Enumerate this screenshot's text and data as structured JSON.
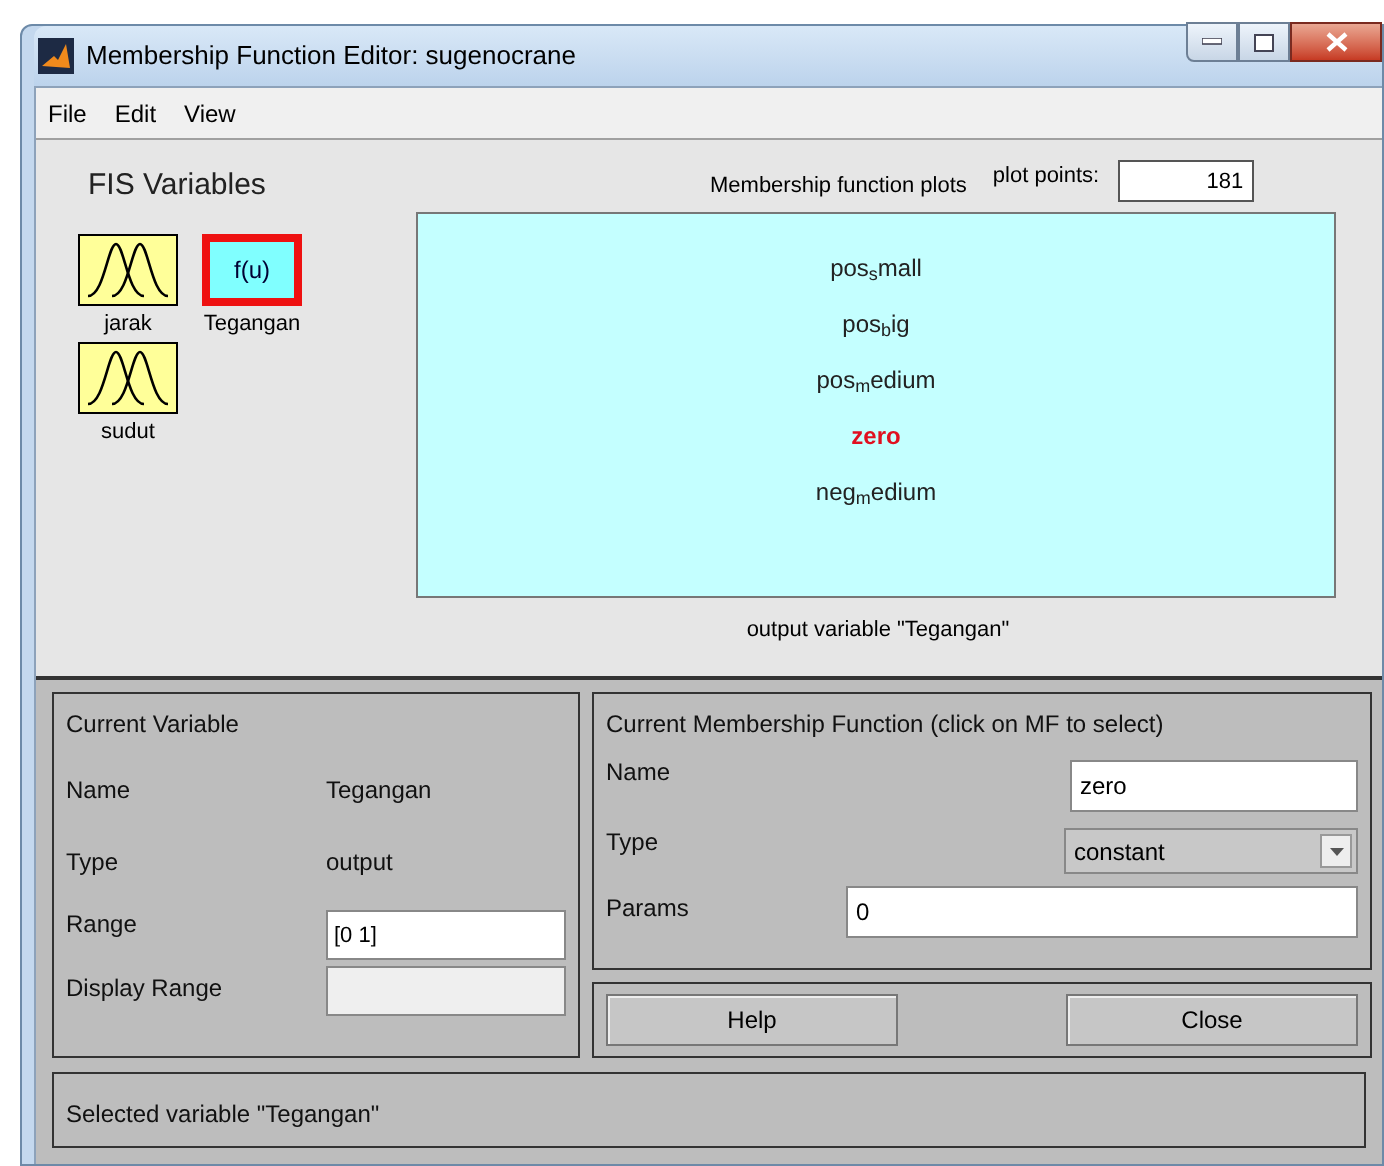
{
  "window": {
    "title": "Membership Function Editor: sugenocrane"
  },
  "menu": [
    "File",
    "Edit",
    "View"
  ],
  "fis_variables": {
    "title": "FIS Variables",
    "items": [
      {
        "label": "jarak",
        "kind": "input",
        "selected": false
      },
      {
        "label": "Tegangan",
        "kind": "output",
        "icon_text": "f(u)",
        "selected": true
      },
      {
        "label": "sudut",
        "kind": "input",
        "selected": false
      }
    ]
  },
  "plot": {
    "title": "Membership function plots",
    "plot_points_label": "plot points:",
    "plot_points": "181",
    "mfs": [
      {
        "label": "pos$_{s}$mall",
        "selected": false
      },
      {
        "label": "pos$_{b}$ig",
        "selected": false
      },
      {
        "label": "pos$_{m}$edium",
        "selected": false
      },
      {
        "label": "zero",
        "selected": true
      },
      {
        "label": "neg$_{m}$edium",
        "selected": false
      }
    ],
    "caption": "output variable \"Tegangan\""
  },
  "current_variable": {
    "title": "Current Variable",
    "name_label": "Name",
    "name": "Tegangan",
    "type_label": "Type",
    "type": "output",
    "range_label": "Range",
    "range": "[0 1]",
    "display_range_label": "Display Range"
  },
  "current_mf": {
    "title": "Current Membership Function (click on MF to select)",
    "name_label": "Name",
    "name": "zero",
    "type_label": "Type",
    "type": "constant",
    "params_label": "Params",
    "params": "0"
  },
  "buttons": [
    "Help",
    "Close"
  ],
  "status": "Selected variable \"Tegangan\""
}
